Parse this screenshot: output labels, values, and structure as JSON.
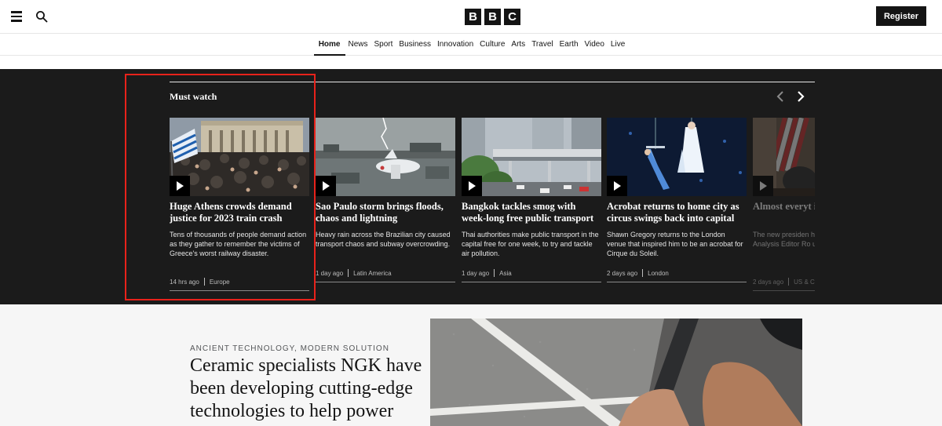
{
  "header": {
    "logo_letters": [
      "B",
      "B",
      "C"
    ],
    "register_label": "Register",
    "menu_icon": "hamburger-icon",
    "search_icon": "search-icon"
  },
  "nav": {
    "items": [
      "Home",
      "News",
      "Sport",
      "Business",
      "Innovation",
      "Culture",
      "Arts",
      "Travel",
      "Earth",
      "Video",
      "Live"
    ],
    "active": "Home"
  },
  "must_watch": {
    "title": "Must watch",
    "cards": [
      {
        "headline": "Huge Athens crowds demand justice for 2023 train crash",
        "summary": "Tens of thousands of people demand action as they gather to remember the victims of Greece's worst railway disaster.",
        "time": "14 hrs ago",
        "region": "Europe"
      },
      {
        "headline": "Sao Paulo storm brings floods, chaos and lightning",
        "summary": "Heavy rain across the Brazilian city caused transport chaos and subway overcrowding.",
        "time": "1 day ago",
        "region": "Latin America"
      },
      {
        "headline": "Bangkok tackles smog with week-long free public transport",
        "summary": "Thai authorities make public transport in the capital free for one week, to try and tackle air pollution.",
        "time": "1 day ago",
        "region": "Asia"
      },
      {
        "headline": "Acrobat returns to home city as circus swings back into capital",
        "summary": "Shawn Gregory returns to the London venue that inspired him to be an acrobat for Cirque du Soleil.",
        "time": "2 days ago",
        "region": "London"
      },
      {
        "headline": "Almost everyt in his whirlwin",
        "summary": "The new presiden heads spin on day Analysis Editor Ro up with what you",
        "time": "2 days ago",
        "region": "US & Ca"
      }
    ]
  },
  "feature": {
    "kicker": "ANCIENT TECHNOLOGY, MODERN SOLUTION",
    "headline": "Ceramic specialists NGK have been developing cutting-edge technologies to help power"
  },
  "colors": {
    "band_bg": "#1b1b1b",
    "highlight": "#e8221b",
    "brand_black": "#141414"
  }
}
